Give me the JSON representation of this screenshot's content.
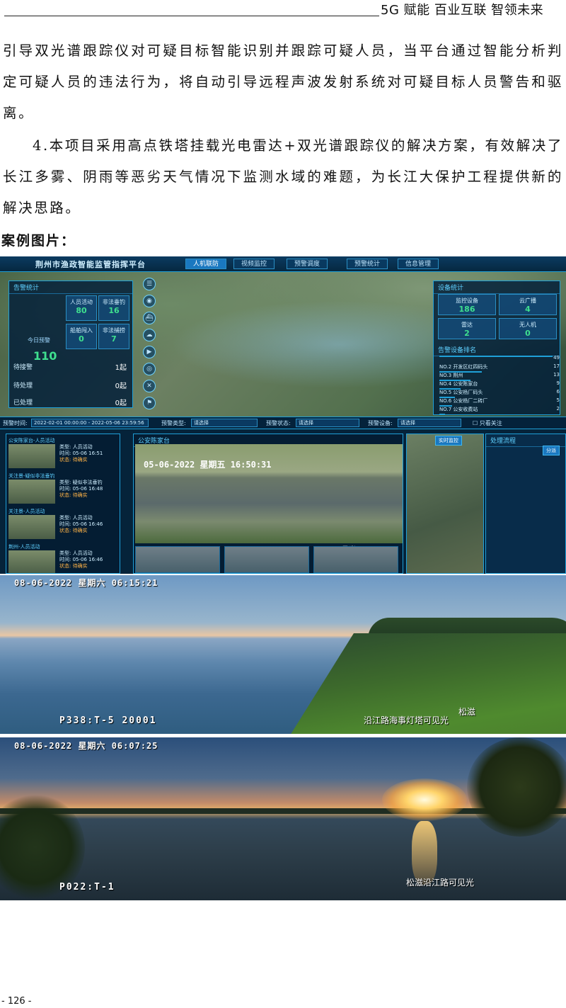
{
  "header": {
    "text": "5G 赋能  百业互联  智领未来"
  },
  "paragraphs": [
    "引导双光谱跟踪仪对可疑目标智能识别并跟踪可疑人员，当平台通过智能分析判定可疑人员的违法行为，将自动引导远程声波发射系统对可疑目标人员警告和驱离。",
    "4.本项目采用高点铁塔挂载光电雷达+双光谱跟踪仪的解决方案，有效解决了长江多雾、阴雨等恶劣天气情况下监测水域的难题，为长江大保护工程提供新的解决思路。"
  ],
  "caption": "案例图片：",
  "dashboard": {
    "title": "荆州市渔政智能监管指挥平台",
    "nav_tabs": [
      "人机联防",
      "视频监控",
      "预警调度",
      "预警统计",
      "信息管理"
    ],
    "alarm_stats": {
      "title": "告警统计",
      "today_label": "今日预警",
      "today_value": "110",
      "boxes": [
        {
          "label": "人员活动",
          "value": "80"
        },
        {
          "label": "非法垂钓",
          "value": "16"
        },
        {
          "label": "船舶闯入",
          "value": "0"
        },
        {
          "label": "非法捕捞",
          "value": "7"
        }
      ],
      "rows": [
        {
          "label": "待接警",
          "value": "1起"
        },
        {
          "label": "待处理",
          "value": "0起"
        },
        {
          "label": "已处理",
          "value": "0起"
        }
      ]
    },
    "device_stats": {
      "title": "设备统计",
      "boxes": [
        {
          "label": "监控设备",
          "value": "186"
        },
        {
          "label": "云广播",
          "value": "4"
        },
        {
          "label": "雷达",
          "value": "2"
        },
        {
          "label": "无人机",
          "value": "0"
        }
      ],
      "rank_title": "告警设备排名",
      "rank": [
        {
          "label": "",
          "value": "49"
        },
        {
          "label": "NO.2 开发区红四码头",
          "value": "17"
        },
        {
          "label": "NO.3 荆州",
          "value": "13"
        },
        {
          "label": "NO.4 公安陈家台",
          "value": "9"
        },
        {
          "label": "NO.5 公安杨厂码头",
          "value": "6"
        },
        {
          "label": "NO.6 公安杨厂二砖厂",
          "value": "5"
        },
        {
          "label": "NO.7 公安收费站",
          "value": "2"
        }
      ]
    },
    "filters": [
      {
        "label": "预警时间:",
        "value": "2022-02-01 00:00:00 - 2022-05-06 23:59:56"
      },
      {
        "label": "预警类型:",
        "value": "请选择"
      },
      {
        "label": "预警状态:",
        "value": "请选择"
      },
      {
        "label": "预警设备:",
        "value": "请选择"
      }
    ],
    "only_watch_label": "只看关注",
    "alarms": [
      {
        "head": "公安陈家台-人员活动",
        "type": "类型: 人员活动",
        "time": "时间: 05-06 16:51",
        "status": "状态: 待确实"
      },
      {
        "head": "关注景-疑似非法垂钓",
        "type": "类型: 疑似非法垂钓",
        "time": "时间: 05-06 16:48",
        "status": "状态: 待确实"
      },
      {
        "head": "关注景-人员活动",
        "type": "类型: 人员活动",
        "time": "时间: 05-06 16:46",
        "status": "状态: 待确实"
      },
      {
        "head": "荆州-人员活动",
        "type": "类型: 人员活动",
        "time": "时间: 05-06 16:46",
        "status": "状态: 待确实"
      }
    ],
    "video": {
      "panel_title": "公安陈家台",
      "timestamp": "05-06-2022  星期五  16:50:31",
      "visible_label": "可见光",
      "live_button": "实时监控"
    },
    "process": {
      "title": "处理流程",
      "button": "分派"
    }
  },
  "photo1": {
    "timestamp": "08-06-2022  星期六  06:15:21",
    "camera_id": "P338:T-5    20001",
    "label": "沿江路海事灯塔可见光",
    "corner_label": "松滋"
  },
  "photo2": {
    "timestamp": "08-06-2022  星期六  06:07:25",
    "camera_id": "P022:T-1",
    "label": "松滋沿江路可见光"
  },
  "page_number": "- 126 -"
}
